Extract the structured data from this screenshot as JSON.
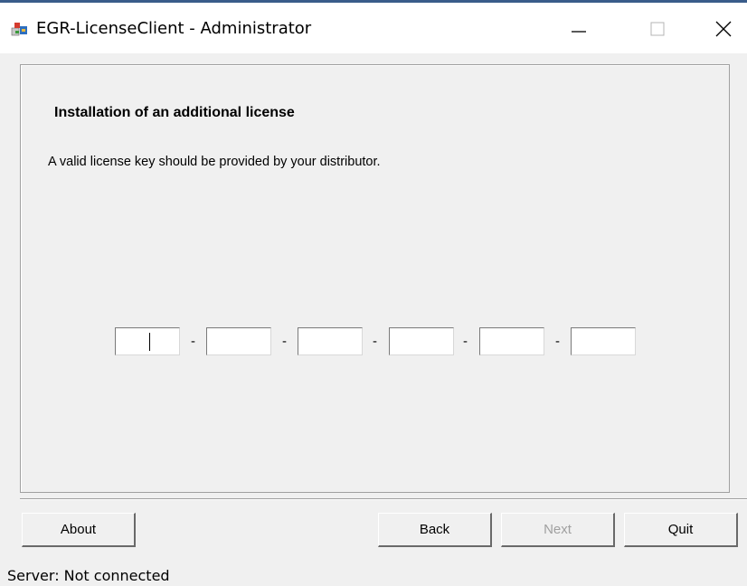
{
  "window": {
    "title": "EGR-LicenseClient - Administrator",
    "icon": "app-icon",
    "controls": [
      "minimize-icon",
      "maximize-icon",
      "close-icon"
    ]
  },
  "content": {
    "heading": "Installation of an additional license",
    "description": "A valid license key should be provided by your distributor."
  },
  "license_key": {
    "separator": "-",
    "fields": [
      "",
      "",
      "",
      "",
      "",
      ""
    ]
  },
  "buttons": {
    "about": "About",
    "back": "Back",
    "next": "Next",
    "quit": "Quit"
  },
  "status": {
    "label": "Server:",
    "value": "Not connected"
  }
}
